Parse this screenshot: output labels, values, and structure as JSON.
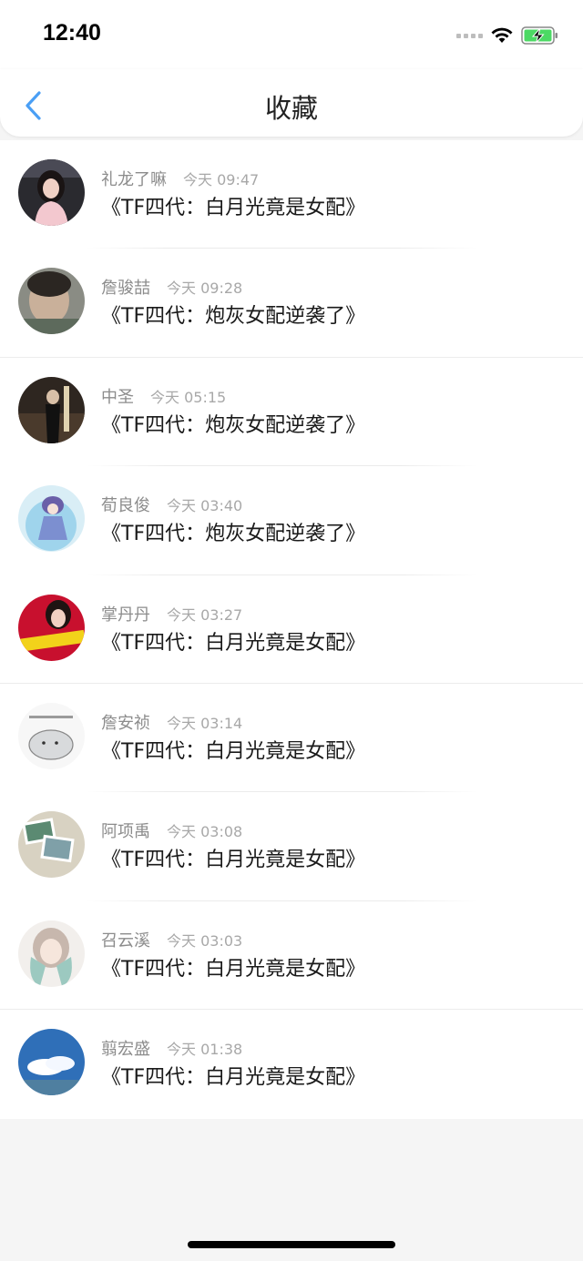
{
  "status": {
    "time": "12:40"
  },
  "nav": {
    "title": "收藏"
  },
  "items": [
    {
      "name": "礼龙了嘛",
      "time": "今天 09:47",
      "text": "《TF四代：白月光竟是女配》",
      "avatar": "avatar-woman-dark-hair"
    },
    {
      "name": "詹骏喆",
      "time": "今天 09:28",
      "text": "《TF四代：炮灰女配逆袭了》",
      "avatar": "avatar-face-closeup"
    },
    {
      "name": "中圣",
      "time": "今天 05:15",
      "text": "《TF四代：炮灰女配逆袭了》",
      "avatar": "avatar-figure-dark"
    },
    {
      "name": "荀良俊",
      "time": "今天 03:40",
      "text": "《TF四代：炮灰女配逆袭了》",
      "avatar": "avatar-anime-girl"
    },
    {
      "name": "掌丹丹",
      "time": "今天 03:27",
      "text": "《TF四代：白月光竟是女配》",
      "avatar": "avatar-red-banner"
    },
    {
      "name": "詹安祯",
      "time": "今天 03:14",
      "text": "《TF四代：白月光竟是女配》",
      "avatar": "avatar-cartoon-hamster"
    },
    {
      "name": "阿项禹",
      "time": "今天 03:08",
      "text": "《TF四代：白月光竟是女配》",
      "avatar": "avatar-photos"
    },
    {
      "name": "召云溪",
      "time": "今天 03:03",
      "text": "《TF四代：白月光竟是女配》",
      "avatar": "avatar-anime-sketch"
    },
    {
      "name": "翦宏盛",
      "time": "今天 01:38",
      "text": "《TF四代：白月光竟是女配》",
      "avatar": "avatar-sky-clouds"
    }
  ],
  "colors": {
    "accent": "#4a9ff5",
    "battery": "#4cd964"
  }
}
